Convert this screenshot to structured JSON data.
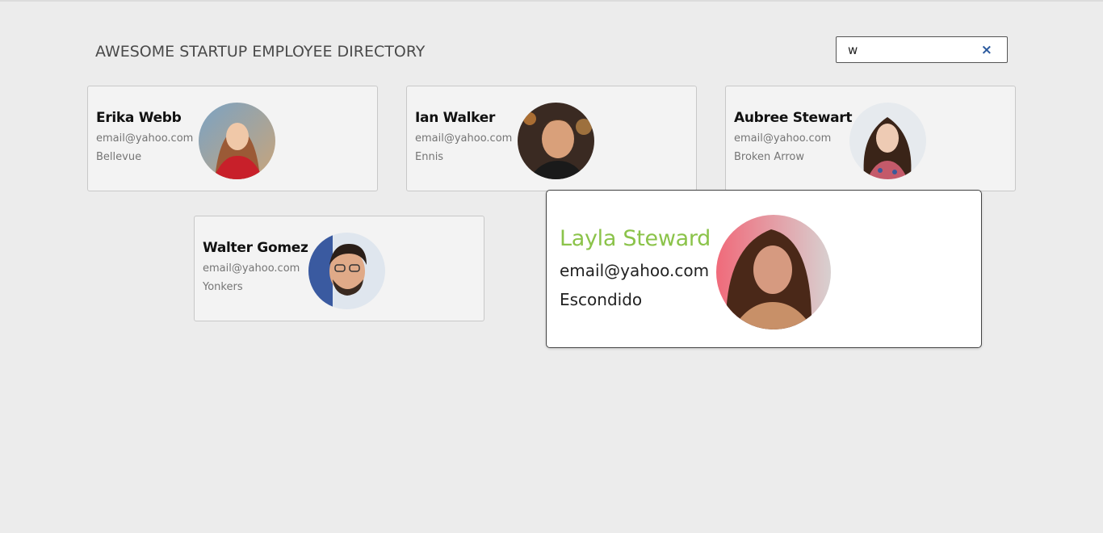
{
  "header": {
    "title": "AWESOME STARTUP EMPLOYEE DIRECTORY"
  },
  "search": {
    "value": "w",
    "clear_icon": "×"
  },
  "employees": [
    {
      "name": "Erika Webb",
      "email": "email@yahoo.com",
      "city": "Bellevue",
      "avatar_icon": "avatar-photo"
    },
    {
      "name": "Ian Walker",
      "email": "email@yahoo.com",
      "city": "Ennis",
      "avatar_icon": "avatar-photo"
    },
    {
      "name": "Aubree Stewart",
      "email": "email@yahoo.com",
      "city": "Broken Arrow",
      "avatar_icon": "avatar-photo"
    },
    {
      "name": "Walter Gomez",
      "email": "email@yahoo.com",
      "city": "Yonkers",
      "avatar_icon": "avatar-photo"
    }
  ],
  "selected": {
    "name": "Layla Steward",
    "email": "email@yahoo.com",
    "city": "Escondido",
    "name_color": "#8bc34a"
  }
}
